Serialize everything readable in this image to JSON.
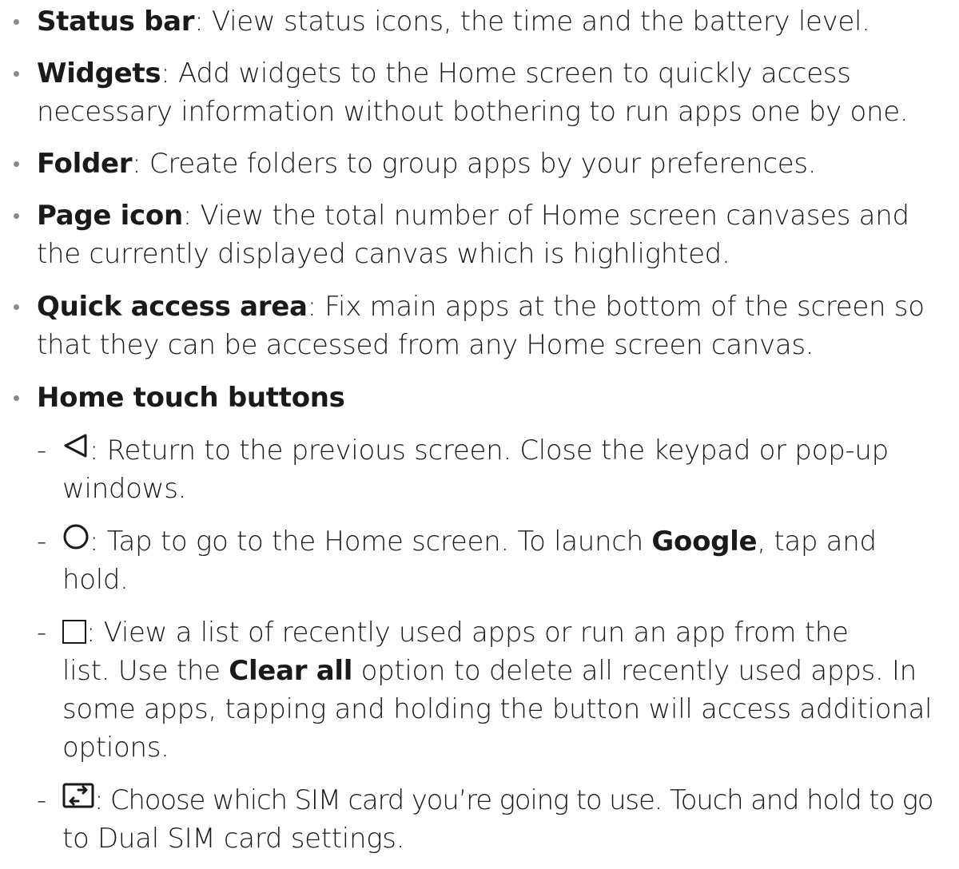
{
  "bullets": [
    {
      "term": "Status bar",
      "desc": ": View status icons, the time and the battery level."
    },
    {
      "term": "Widgets",
      "desc1": ": Add widgets to the Home screen to quickly access",
      "desc2": "necessary information without bothering to run apps one by one."
    },
    {
      "term": "Folder",
      "desc": ": Create folders to group apps by your preferences."
    },
    {
      "term": "Page icon",
      "desc1": ": View the total number of Home screen canvases and",
      "desc2": "the currently displayed canvas which is highlighted."
    },
    {
      "term": "Quick access area",
      "desc1": ": Fix main apps at the bottom of the screen so",
      "desc2": "that they can be accessed from any Home screen canvas."
    },
    {
      "term": "Home touch buttons"
    }
  ],
  "buttons": {
    "dash": "-",
    "back": {
      "icon": "back-triangle-icon",
      "line1": ": Return to the previous screen. Close the keypad or pop-up",
      "line2": "windows."
    },
    "home": {
      "icon": "home-circle-icon",
      "line1_a": ": Tap to go to the Home screen. To launch ",
      "line1_bold": "Google",
      "line1_b": ", tap and",
      "line2": "hold."
    },
    "recent": {
      "icon": "recent-square-icon",
      "line1": ": View a list of recently used apps or run an app from the",
      "line2_a": "list. Use the ",
      "line2_bold": "Clear all",
      "line2_b": " option to delete all recently used apps. In",
      "line3": "some apps, tapping and holding the button will access additional",
      "line4": "options."
    },
    "sim": {
      "icon": "sim-switch-icon",
      "line1": ": Choose which SIM card you’re going to use. Touch and hold to go",
      "line2": "to Dual SIM card settings."
    }
  }
}
